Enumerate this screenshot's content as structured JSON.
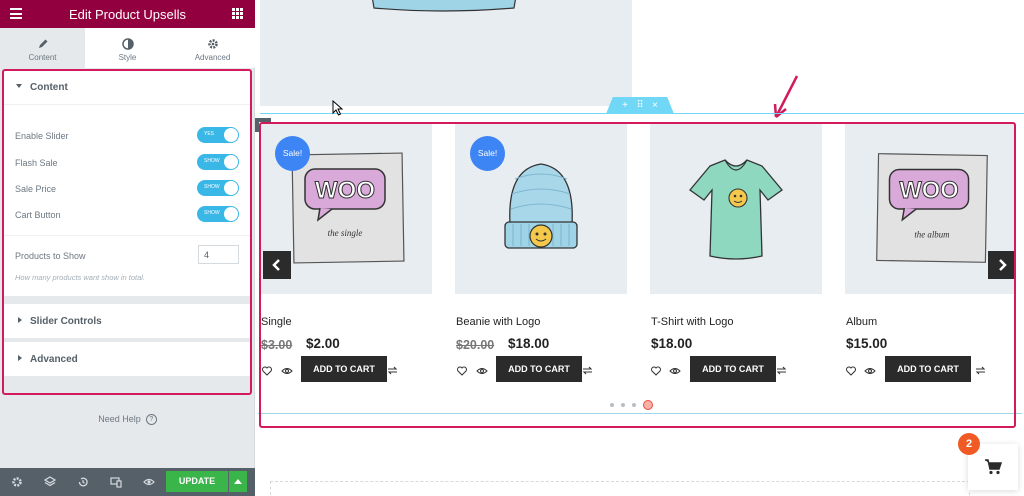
{
  "editor": {
    "title": "Edit Product Upsells",
    "tabs": [
      {
        "label": "Content",
        "icon": "pencil-icon"
      },
      {
        "label": "Style",
        "icon": "half-circle-icon"
      },
      {
        "label": "Advanced",
        "icon": "gear-icon"
      }
    ],
    "sections": {
      "content": "Content",
      "slider_controls": "Slider Controls",
      "advanced": "Advanced"
    },
    "controls": [
      {
        "label": "Enable Slider",
        "toggle_text": "YES",
        "on": true
      },
      {
        "label": "Flash Sale",
        "toggle_text": "SHOW",
        "on": true
      },
      {
        "label": "Sale Price",
        "toggle_text": "SHOW",
        "on": true
      },
      {
        "label": "Cart Button",
        "toggle_text": "SHOW",
        "on": true
      }
    ],
    "products_to_show": {
      "label": "Products to Show",
      "value": "4",
      "description": "How many products want show in total."
    },
    "need_help": "Need Help",
    "footer": {
      "update_label": "UPDATE"
    },
    "accent_color": "#93003f",
    "toggle_color": "#39b7e6",
    "update_color": "#39b54a"
  },
  "products": [
    {
      "name": "Single",
      "old_price": "$3.00",
      "price": "$2.00",
      "sale": true,
      "sale_label": "Sale!",
      "image": "woo-single-icon",
      "cart_label": "ADD TO CART"
    },
    {
      "name": "Beanie with Logo",
      "old_price": "$20.00",
      "price": "$18.00",
      "sale": true,
      "sale_label": "Sale!",
      "image": "beanie-icon",
      "cart_label": "ADD TO CART"
    },
    {
      "name": "T-Shirt with Logo",
      "old_price": "",
      "price": "$18.00",
      "sale": false,
      "image": "tshirt-icon",
      "cart_label": "ADD TO CART"
    },
    {
      "name": "Album",
      "old_price": "",
      "price": "$15.00",
      "sale": false,
      "image": "woo-album-icon",
      "cart_label": "ADD TO CART"
    }
  ],
  "slider": {
    "dot_count": 4,
    "active_dot": 4
  },
  "cart": {
    "count": "2"
  },
  "colors": {
    "sale_badge": "#3d84f5",
    "annotation": "#d21a5d",
    "cart_badge": "#f05a24"
  }
}
